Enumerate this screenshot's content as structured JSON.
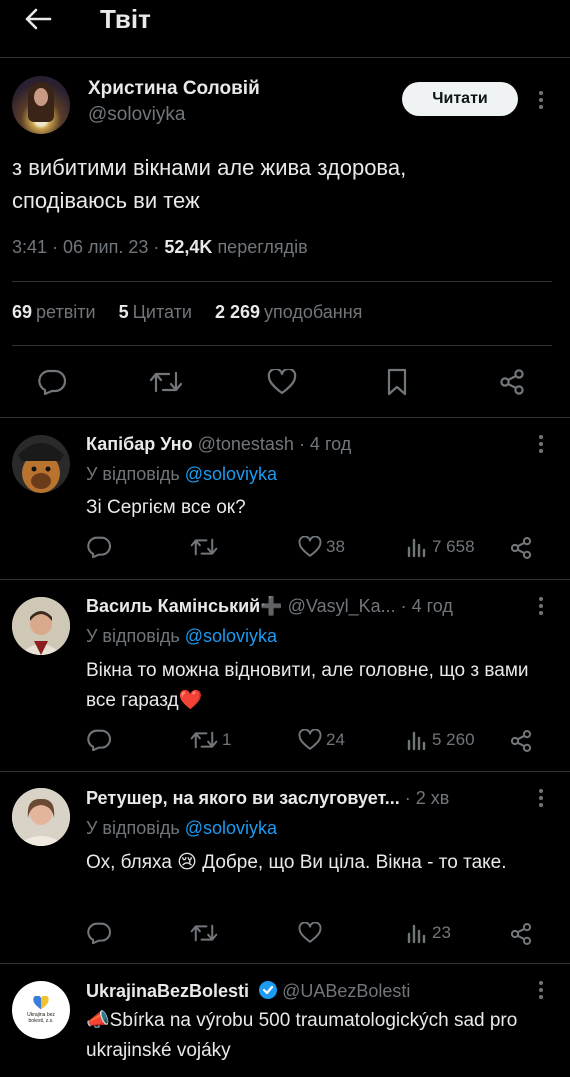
{
  "header": {
    "title": "Твіт"
  },
  "tweet": {
    "name": "Христина Соловій",
    "handle": "@soloviyka",
    "follow_label": "Читати",
    "text_line1": "з вибитими вікнами але жива здорова,",
    "text_line2": "сподіваюсь ви теж",
    "time": "3:41 · 06 лип. 23 · ",
    "views": "52,4K",
    "views_label": " переглядів",
    "retweets": "69",
    "retweets_label": "ретвіти",
    "quotes": "5",
    "quotes_label": "Цитати",
    "likes": "2 269",
    "likes_label": "уподобання"
  },
  "replies": [
    {
      "name": "Капібар Уно",
      "handle": "@tonestash",
      "time": " · 4 год",
      "reply_prefix": "У відповідь ",
      "reply_to": "@soloviyka",
      "text": "Зі Сергієм все ок?",
      "retweets": "",
      "likes": "38",
      "views": "7 658"
    },
    {
      "name": "Василь Камінський➕",
      "handle": "@Vasyl_Ka...",
      "time": " · 4 год",
      "reply_prefix": "У відповідь ",
      "reply_to": "@soloviyka",
      "text": "Вікна то можна відновити, але головне, що з вами все гаразд❤️",
      "retweets": "1",
      "likes": "24",
      "views": "5 260"
    },
    {
      "name": "Ретушер, на якого ви заслуговует...",
      "handle": "",
      "time": " · 2 хв",
      "reply_prefix": "У відповідь ",
      "reply_to": "@soloviyka",
      "text": "Ох, бляха 😢 Добре, що Ви ціла. Вікна - то таке.",
      "retweets": "",
      "likes": "",
      "views": "23"
    },
    {
      "name": "UkrajinaBezBolesti",
      "handle": "@UABezBolesti",
      "avatar_text": "Ukrajina bez bolesti, z.s.",
      "text": "📣Sbírka na výrobu 500 traumatologických sad pro ukrajinské vojáky"
    }
  ],
  "colors": {
    "background": "#000000",
    "accent": "#1d9bf0",
    "muted": "#71767b",
    "text": "#e7e9ea",
    "verified": "#1d9bf0"
  }
}
